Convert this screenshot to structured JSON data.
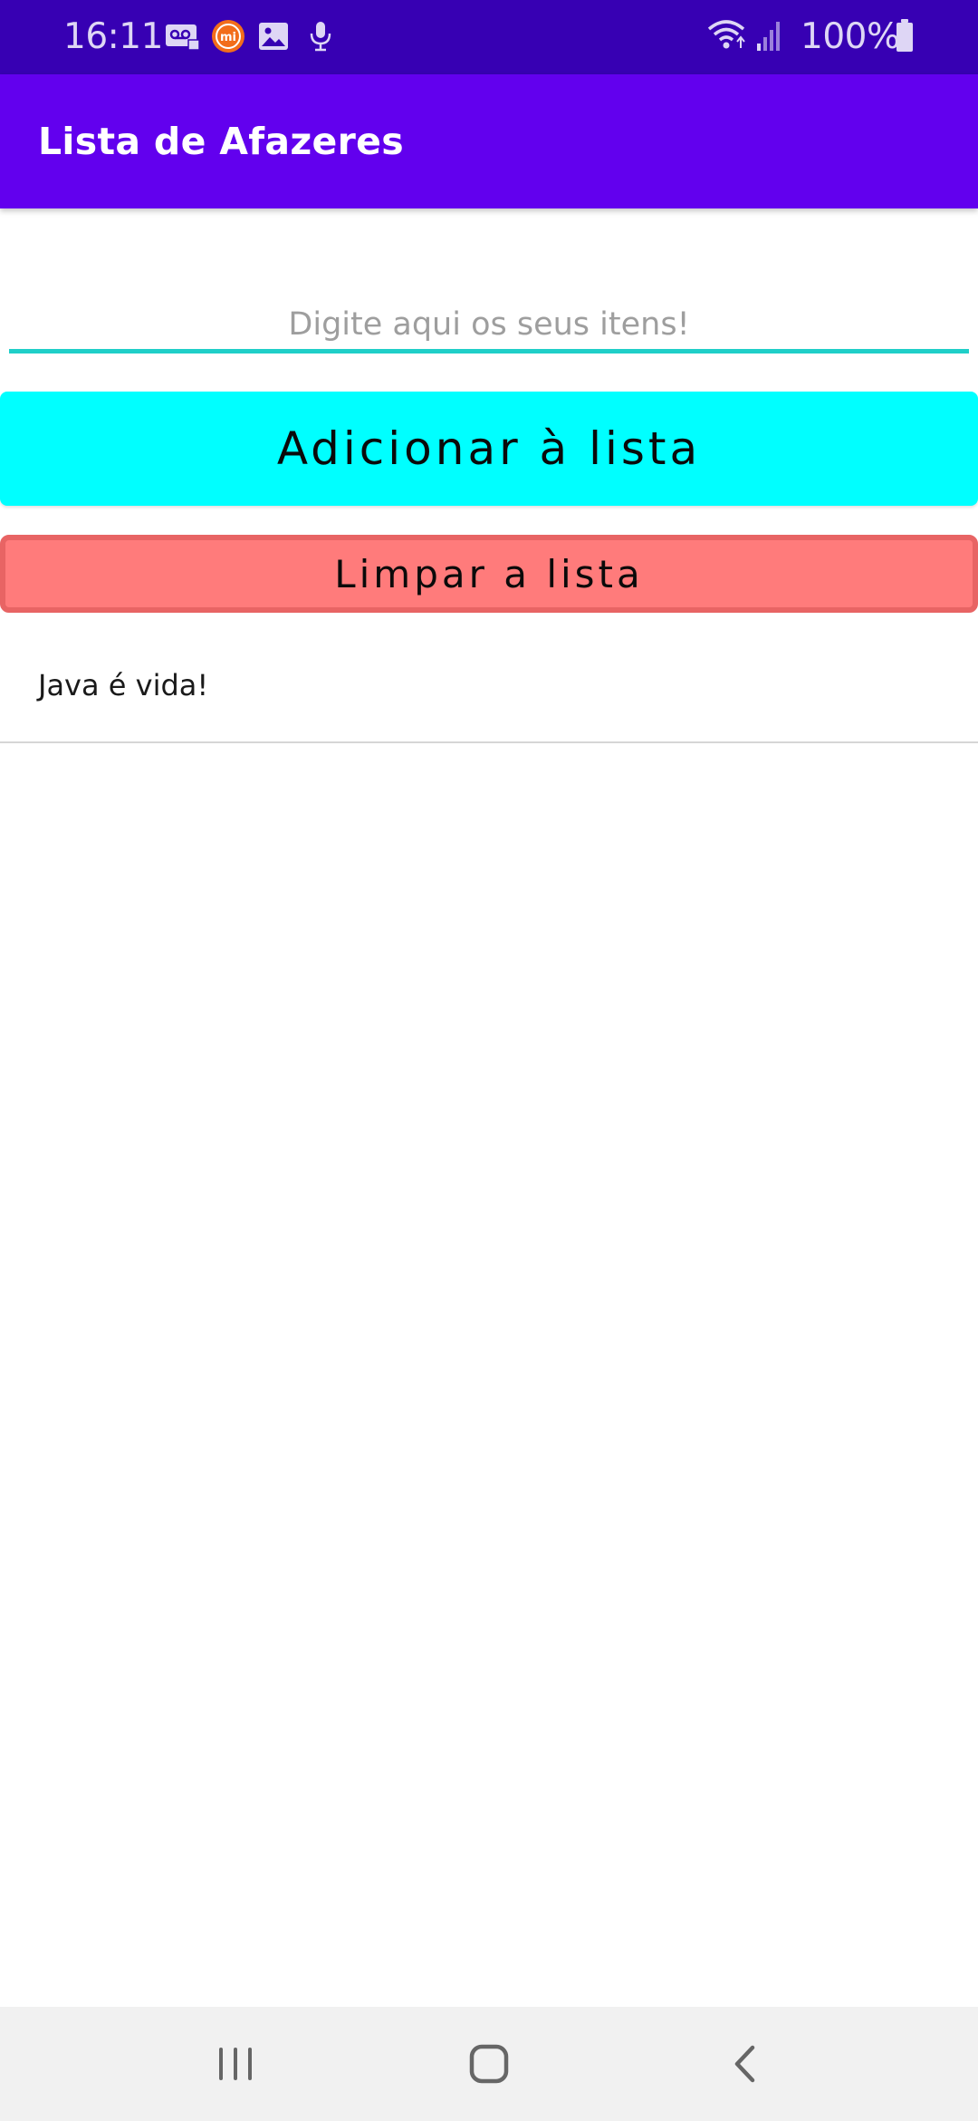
{
  "status_bar": {
    "time": "16:11",
    "battery": "100%",
    "icons": [
      "voicemail-icon",
      "mi-icon",
      "gallery-icon",
      "microphone-icon",
      "wifi-icon",
      "signal-icon",
      "battery-icon"
    ]
  },
  "app_bar": {
    "title": "Lista de Afazeres"
  },
  "input": {
    "placeholder": "Digite aqui os seus itens!",
    "value": ""
  },
  "buttons": {
    "add_label": "Adicionar à lista",
    "clear_label": "Limpar a lista"
  },
  "list": {
    "items": [
      "Java é vida!"
    ]
  },
  "nav_bar": {
    "icons": [
      "recent-apps-icon",
      "home-icon",
      "back-icon"
    ]
  },
  "colors": {
    "status_bar": "#3700b3",
    "app_bar": "#6200ee",
    "add_button": "#00ffff",
    "clear_button": "#ff7b7b",
    "input_underline": "#1fcfc8"
  }
}
